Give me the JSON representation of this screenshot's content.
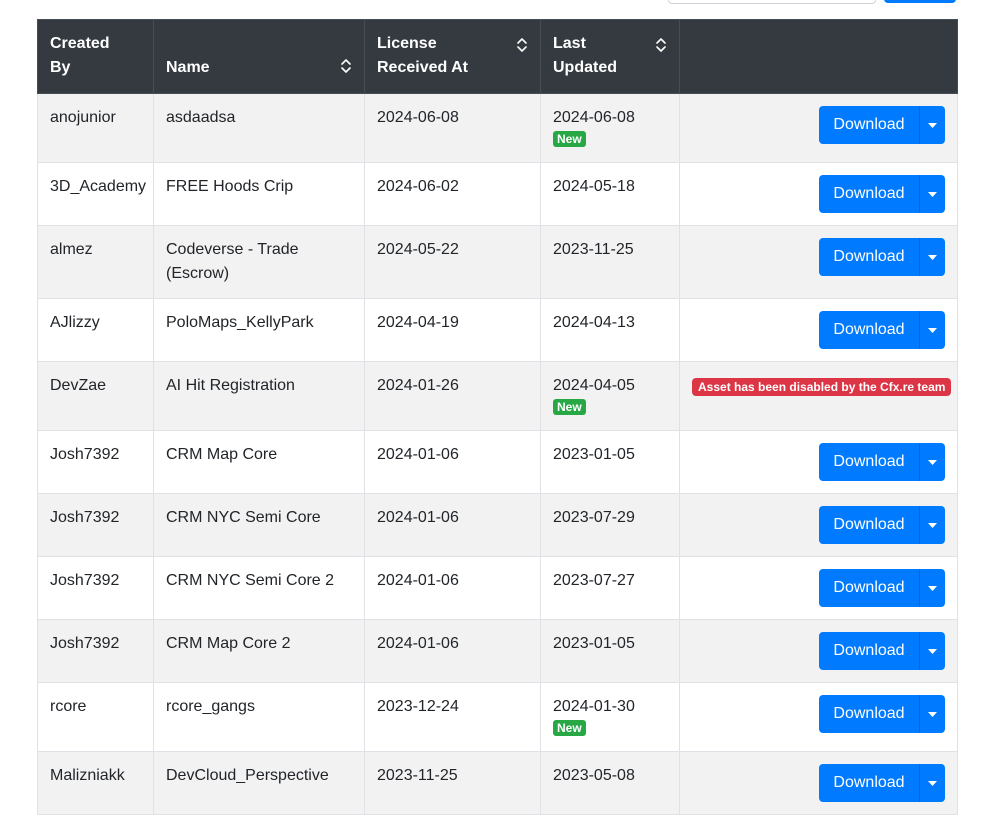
{
  "header": {
    "columns": [
      {
        "label": "Created By",
        "sortable": false
      },
      {
        "label": "Name",
        "sortable": true
      },
      {
        "label": "License Received At",
        "sortable": true
      },
      {
        "label": "Last Updated",
        "sortable": true
      },
      {
        "label": "",
        "sortable": false
      }
    ]
  },
  "labels": {
    "download": "Download",
    "new_badge": "New",
    "disabled_badge": "Asset has been disabled by the Cfx.re team"
  },
  "colors": {
    "header_bg": "#343a40",
    "primary": "#007bff",
    "success": "#28a745",
    "danger": "#dc3545",
    "stripe": "#f2f2f2"
  },
  "rows": [
    {
      "created_by": "anojunior",
      "name": "asdaadsa",
      "license_received": "2024-06-08",
      "last_updated": "2024-06-08",
      "is_new": true,
      "disabled": false
    },
    {
      "created_by": "3D_Academy",
      "name": "FREE Hoods Crip",
      "license_received": "2024-06-02",
      "last_updated": "2024-05-18",
      "is_new": false,
      "disabled": false
    },
    {
      "created_by": "almez",
      "name": "Codeverse - Trade (Escrow)",
      "license_received": "2024-05-22",
      "last_updated": "2023-11-25",
      "is_new": false,
      "disabled": false
    },
    {
      "created_by": "AJlizzy",
      "name": "PoloMaps_KellyPark",
      "license_received": "2024-04-19",
      "last_updated": "2024-04-13",
      "is_new": false,
      "disabled": false
    },
    {
      "created_by": "DevZae",
      "name": "AI Hit Registration",
      "license_received": "2024-01-26",
      "last_updated": "2024-04-05",
      "is_new": true,
      "disabled": true
    },
    {
      "created_by": "Josh7392",
      "name": "CRM Map Core",
      "license_received": "2024-01-06",
      "last_updated": "2023-01-05",
      "is_new": false,
      "disabled": false
    },
    {
      "created_by": "Josh7392",
      "name": "CRM NYC Semi Core",
      "license_received": "2024-01-06",
      "last_updated": "2023-07-29",
      "is_new": false,
      "disabled": false
    },
    {
      "created_by": "Josh7392",
      "name": "CRM NYC Semi Core 2",
      "license_received": "2024-01-06",
      "last_updated": "2023-07-27",
      "is_new": false,
      "disabled": false
    },
    {
      "created_by": "Josh7392",
      "name": "CRM Map Core 2",
      "license_received": "2024-01-06",
      "last_updated": "2023-01-05",
      "is_new": false,
      "disabled": false
    },
    {
      "created_by": "rcore",
      "name": "rcore_gangs",
      "license_received": "2023-12-24",
      "last_updated": "2024-01-30",
      "is_new": true,
      "disabled": false
    },
    {
      "created_by": "Malizniakk",
      "name": "DevCloud_Perspective",
      "license_received": "2023-11-25",
      "last_updated": "2023-05-08",
      "is_new": false,
      "disabled": false
    }
  ]
}
